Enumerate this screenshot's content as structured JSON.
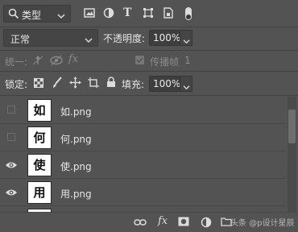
{
  "filter": {
    "kind_label": "类型"
  },
  "blend": {
    "mode": "正常",
    "opacity_label": "不透明度:",
    "opacity_value": "100%"
  },
  "unify": {
    "label": "统一:",
    "propagate_label": "传播帧",
    "propagate_value": "1"
  },
  "lock": {
    "label": "锁定:",
    "fill_label": "填充:",
    "fill_value": "100%"
  },
  "layers": [
    {
      "thumb": "如",
      "name": "如.png",
      "visible": false
    },
    {
      "thumb": "何",
      "name": "何.png",
      "visible": false
    },
    {
      "thumb": "使",
      "name": "使.png",
      "visible": true
    },
    {
      "thumb": "用",
      "name": "用.png",
      "visible": true
    }
  ],
  "watermark": "头条 @p设计星辰"
}
